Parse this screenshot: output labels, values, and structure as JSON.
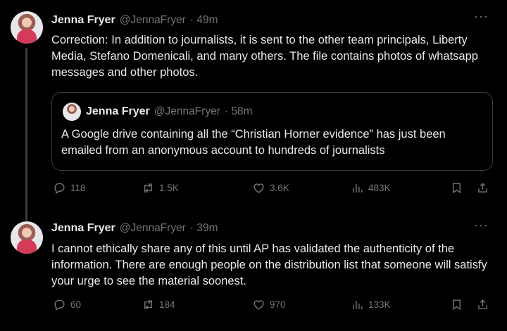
{
  "tweets": [
    {
      "name": "Jenna Fryer",
      "handle": "@JennaFryer",
      "time": "· 49m",
      "more": "···",
      "text": "Correction: In addition to journalists, it is sent to the other team principals, Liberty Media, Stefano Domenicali, and many others. The file contains photos of whatsapp messages and other photos.",
      "quote": {
        "name": "Jenna Fryer",
        "handle": "@JennaFryer",
        "time": "· 58m",
        "text": "A Google drive containing all the “Christian Horner evidence” has just been emailed from an anonymous account to hundreds of journalists"
      },
      "stats": {
        "replies": "118",
        "reposts": "1.5K",
        "likes": "3.6K",
        "views": "483K"
      }
    },
    {
      "name": "Jenna Fryer",
      "handle": "@JennaFryer",
      "time": "· 39m",
      "more": "···",
      "text": "I cannot ethically share any of this until AP has validated the authenticity of the information. There are enough people on the distribution list that someone will satisfy your urge to see the material soonest.",
      "stats": {
        "replies": "60",
        "reposts": "184",
        "likes": "970",
        "views": "133K"
      }
    }
  ],
  "icons": {
    "reply": "reply-icon",
    "repost": "repost-icon",
    "like": "heart-icon",
    "views": "views-icon",
    "bookmark": "bookmark-icon",
    "share": "share-icon"
  }
}
